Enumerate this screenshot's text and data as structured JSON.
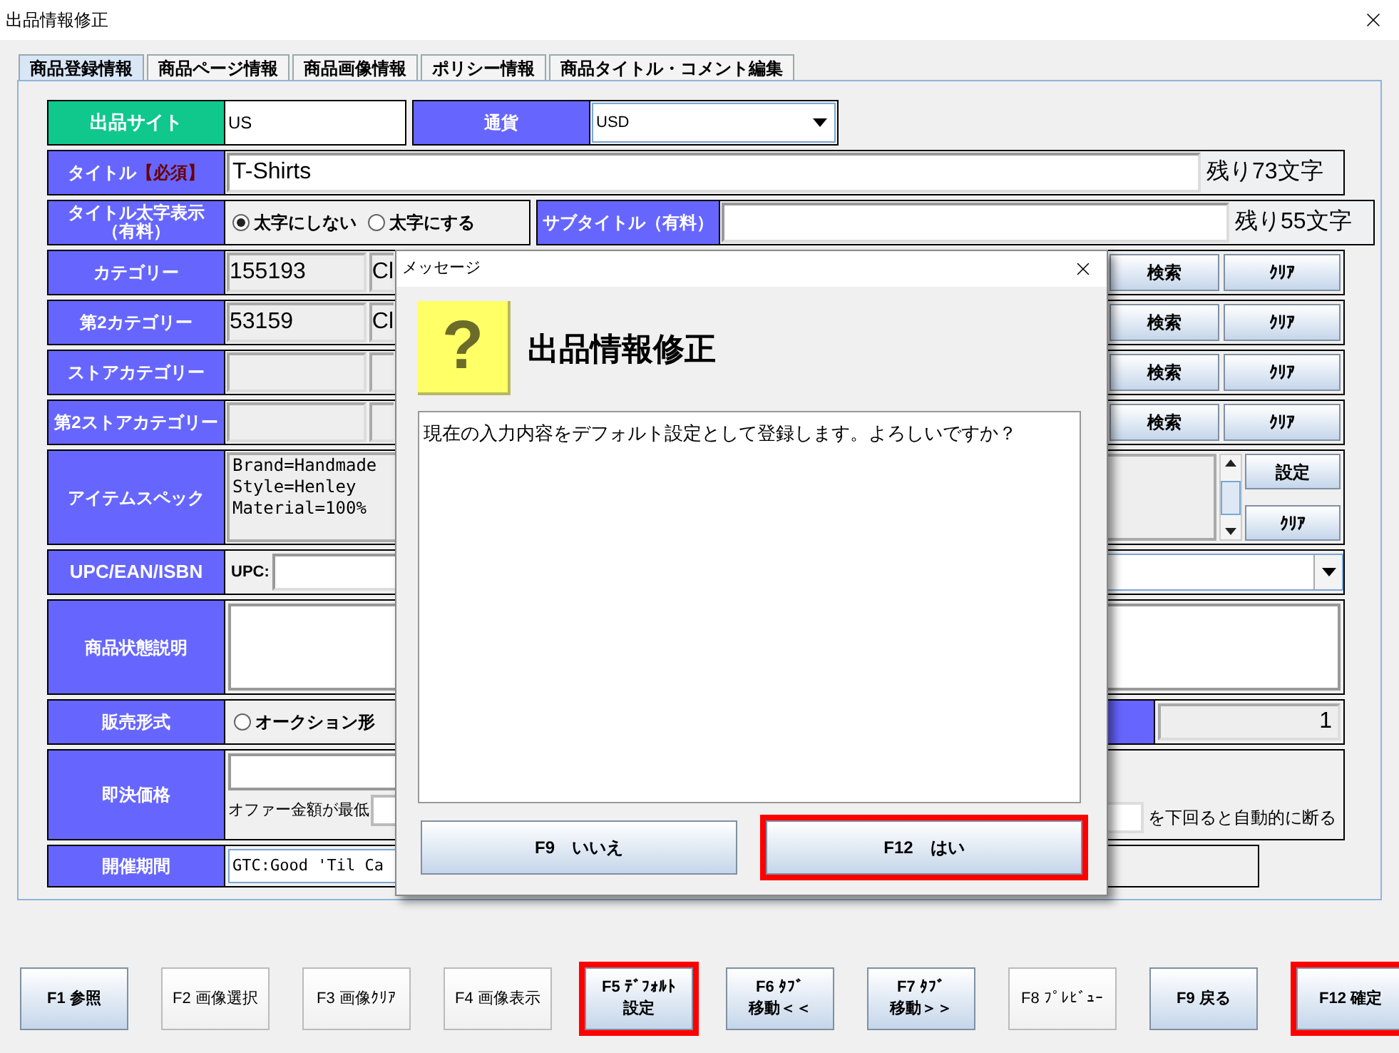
{
  "window": {
    "title": "出品情報修正"
  },
  "tabs": [
    {
      "label": "商品登録情報",
      "selected": true
    },
    {
      "label": "商品ページ情報",
      "selected": false
    },
    {
      "label": "商品画像情報",
      "selected": false
    },
    {
      "label": "ポリシー情報",
      "selected": false
    },
    {
      "label": "商品タイトル・コメント編集",
      "selected": false
    }
  ],
  "form": {
    "site": {
      "label": "出品サイト",
      "value": "US"
    },
    "currency": {
      "label": "通貨",
      "value": "USD"
    },
    "title": {
      "label": "タイトル",
      "required": "【必須】",
      "value": "T-Shirts",
      "remaining": "残り73文字"
    },
    "bold_title": {
      "label": "タイトル太字表示（有料）",
      "options": [
        {
          "label": "太字にしない",
          "selected": true
        },
        {
          "label": "太字にする",
          "selected": false
        }
      ]
    },
    "subtitle": {
      "label": "サブタイトル（有料）",
      "remaining": "残り55文字"
    },
    "categories": [
      {
        "label": "カテゴリー",
        "id": "155193",
        "name": "Cl",
        "search": "検索",
        "clear": "ｸﾘｱ"
      },
      {
        "label": "第2カテゴリー",
        "id": "53159",
        "name": "Cl",
        "search": "検索",
        "clear": "ｸﾘｱ"
      },
      {
        "label": "ストアカテゴリー",
        "search": "検索",
        "clear": "ｸﾘｱ"
      },
      {
        "label": "第2ストアカテゴリー",
        "search": "検索",
        "clear": "ｸﾘｱ"
      }
    ],
    "item_spec": {
      "label": "アイテムスペック",
      "lines": [
        "Brand=Handmade",
        "Style=Henley",
        "Material=100%"
      ],
      "set": "設定",
      "clear": "ｸﾘｱ"
    },
    "upc": {
      "label": "UPC/EAN/ISBN",
      "prefix": "UPC:"
    },
    "condition": {
      "label": "商品状態説明"
    },
    "format": {
      "label": "販売形式",
      "option": {
        "label": "オークション形",
        "selected": false
      },
      "quantity": "1"
    },
    "buy_now": {
      "label": "即決価格",
      "offer_text": "オファー金額が最低",
      "offer_suffix": "を下回ると自動的に断る"
    },
    "duration": {
      "label": "開催期間",
      "value": "GTC:Good 'Til Ca"
    }
  },
  "dialog": {
    "title": "メッセージ",
    "icon_text": "?",
    "heading": "出品情報修正",
    "message": "現在の入力内容をデフォルト設定として登録します。よろしいですか？",
    "buttons": [
      {
        "label": "F9　いいえ",
        "highlighted": false
      },
      {
        "label": "F12　はい",
        "highlighted": true
      }
    ]
  },
  "footer_buttons": [
    {
      "lines": [
        "F1 参照"
      ],
      "disabled": false,
      "highlighted": false
    },
    {
      "lines": [
        "F2 画像選択"
      ],
      "disabled": true,
      "highlighted": false
    },
    {
      "lines": [
        "F3 画像ｸﾘｱ"
      ],
      "disabled": true,
      "highlighted": false
    },
    {
      "lines": [
        "F4 画像表示"
      ],
      "disabled": true,
      "highlighted": false
    },
    {
      "lines": [
        "F5 ﾃﾞﾌｫﾙﾄ",
        "設定"
      ],
      "disabled": false,
      "highlighted": true
    },
    {
      "lines": [
        "F6 ﾀﾌﾞ",
        "移動＜＜"
      ],
      "disabled": false,
      "highlighted": false
    },
    {
      "lines": [
        "F7 ﾀﾌﾞ",
        "移動＞＞"
      ],
      "disabled": false,
      "highlighted": false
    },
    {
      "lines": [
        "F8 ﾌﾟﾚﾋﾞｭｰ"
      ],
      "disabled": true,
      "highlighted": false
    },
    {
      "lines": [
        "F9 戻る"
      ],
      "disabled": false,
      "highlighted": false
    },
    {
      "lines": [
        "F12 確定"
      ],
      "disabled": false,
      "highlighted": true
    }
  ]
}
